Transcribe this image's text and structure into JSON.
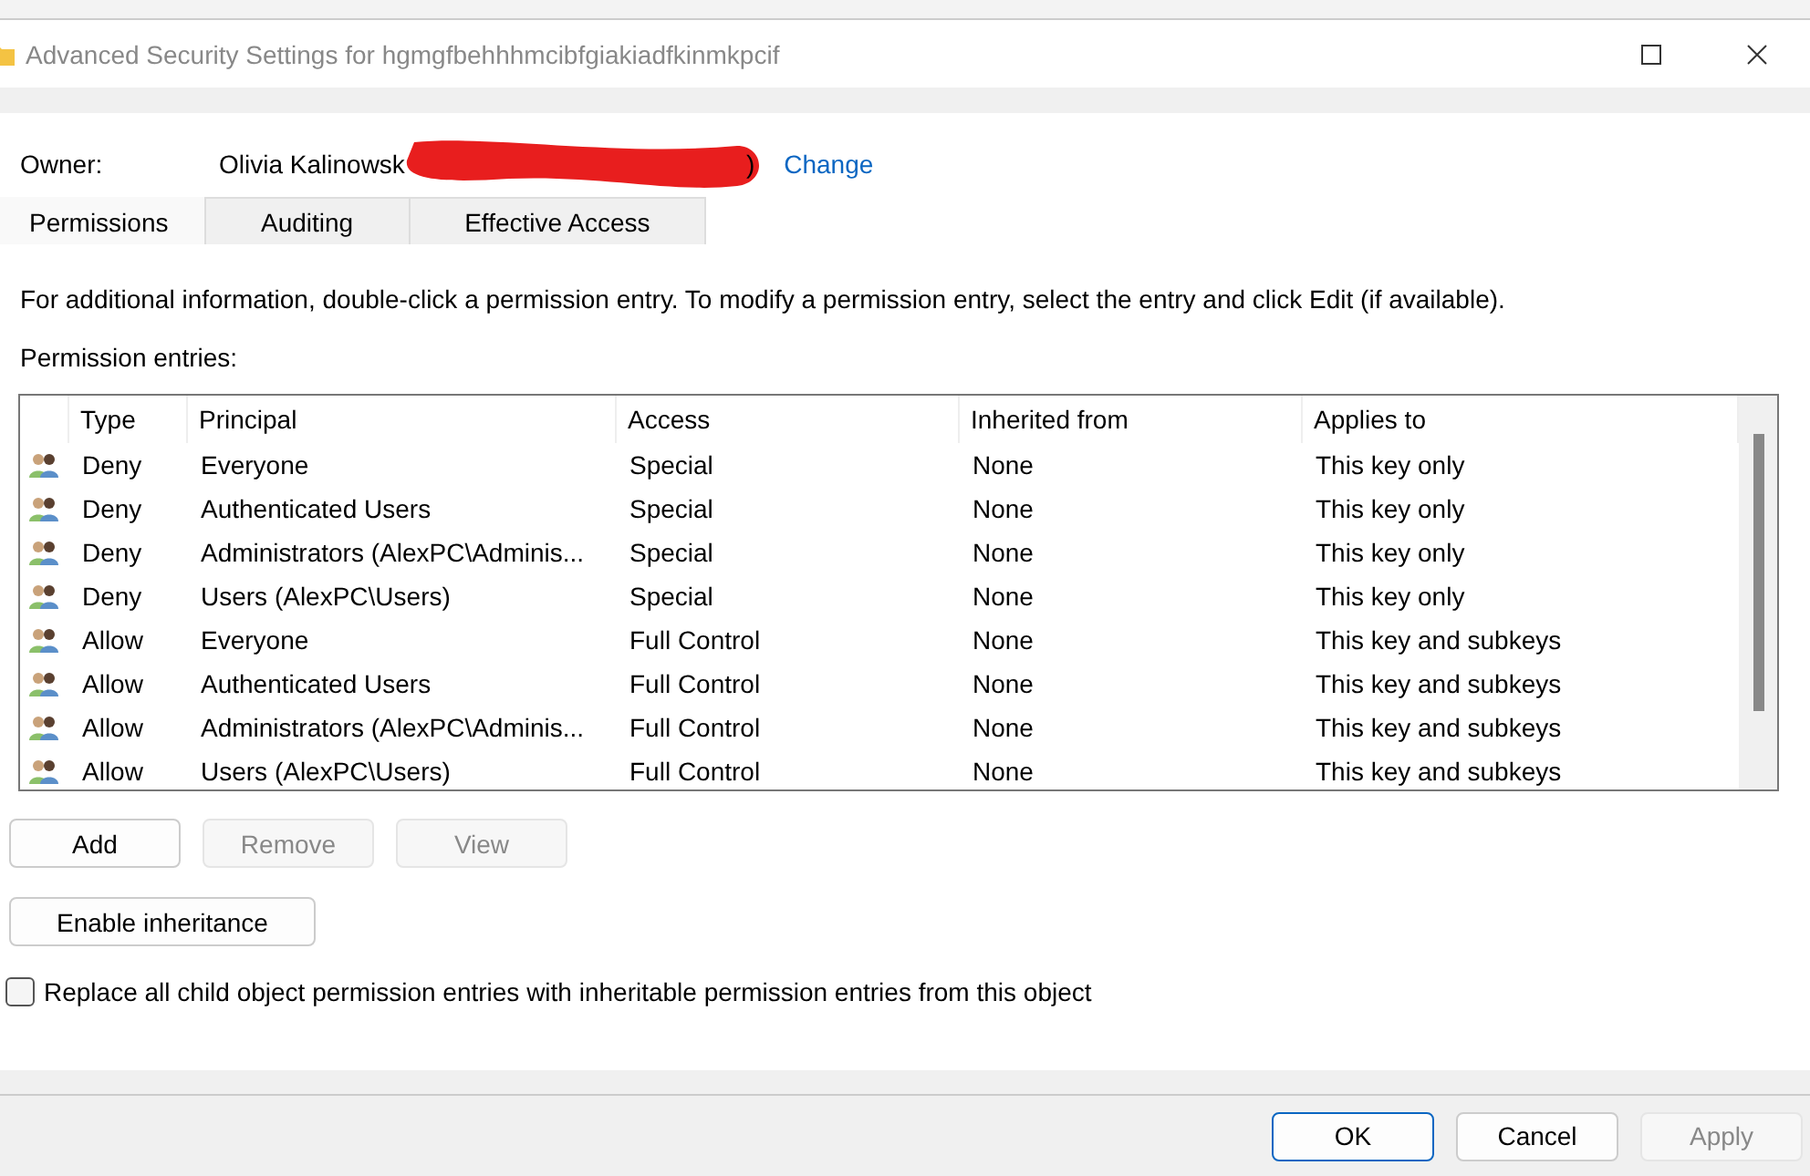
{
  "window": {
    "title": "Advanced Security Settings for hgmgfbehhhmcibfgiakiadfkinmkpcif"
  },
  "owner": {
    "label": "Owner:",
    "value": "Olivia Kalinowsk",
    "value_end": ")",
    "link": "Change"
  },
  "tabs": [
    {
      "label": "Permissions",
      "selected": true
    },
    {
      "label": "Auditing",
      "selected": false
    },
    {
      "label": "Effective Access",
      "selected": false
    }
  ],
  "info": "For additional information, double-click a permission entry. To modify a permission entry, select the entry and click Edit (if available).",
  "entries_label": "Permission entries:",
  "table": {
    "columns": [
      "Type",
      "Principal",
      "Access",
      "Inherited from",
      "Applies to"
    ],
    "rows": [
      {
        "type": "Deny",
        "principal": "Everyone",
        "access": "Special",
        "inherited_from": "None",
        "applies_to": "This key only"
      },
      {
        "type": "Deny",
        "principal": "Authenticated Users",
        "access": "Special",
        "inherited_from": "None",
        "applies_to": "This key only"
      },
      {
        "type": "Deny",
        "principal": "Administrators (AlexPC\\Adminis...",
        "access": "Special",
        "inherited_from": "None",
        "applies_to": "This key only"
      },
      {
        "type": "Deny",
        "principal": "Users (AlexPC\\Users)",
        "access": "Special",
        "inherited_from": "None",
        "applies_to": "This key only"
      },
      {
        "type": "Allow",
        "principal": "Everyone",
        "access": "Full Control",
        "inherited_from": "None",
        "applies_to": "This key and subkeys"
      },
      {
        "type": "Allow",
        "principal": "Authenticated Users",
        "access": "Full Control",
        "inherited_from": "None",
        "applies_to": "This key and subkeys"
      },
      {
        "type": "Allow",
        "principal": "Administrators (AlexPC\\Adminis...",
        "access": "Full Control",
        "inherited_from": "None",
        "applies_to": "This key and subkeys"
      },
      {
        "type": "Allow",
        "principal": "Users (AlexPC\\Users)",
        "access": "Full Control",
        "inherited_from": "None",
        "applies_to": "This key and subkeys"
      }
    ]
  },
  "entry_buttons": [
    {
      "label": "Add",
      "disabled": false
    },
    {
      "label": "Remove",
      "disabled": true
    },
    {
      "label": "View",
      "disabled": true
    }
  ],
  "inheritance_button": {
    "label": "Enable inheritance"
  },
  "replace_checkbox": {
    "label": "Replace all child object permission entries with inheritable permission entries from this object",
    "checked": false
  },
  "dialog_buttons": [
    {
      "label": "OK",
      "default": true,
      "disabled": false
    },
    {
      "label": "Cancel",
      "default": false,
      "disabled": false
    },
    {
      "label": "Apply",
      "default": false,
      "disabled": true
    }
  ]
}
